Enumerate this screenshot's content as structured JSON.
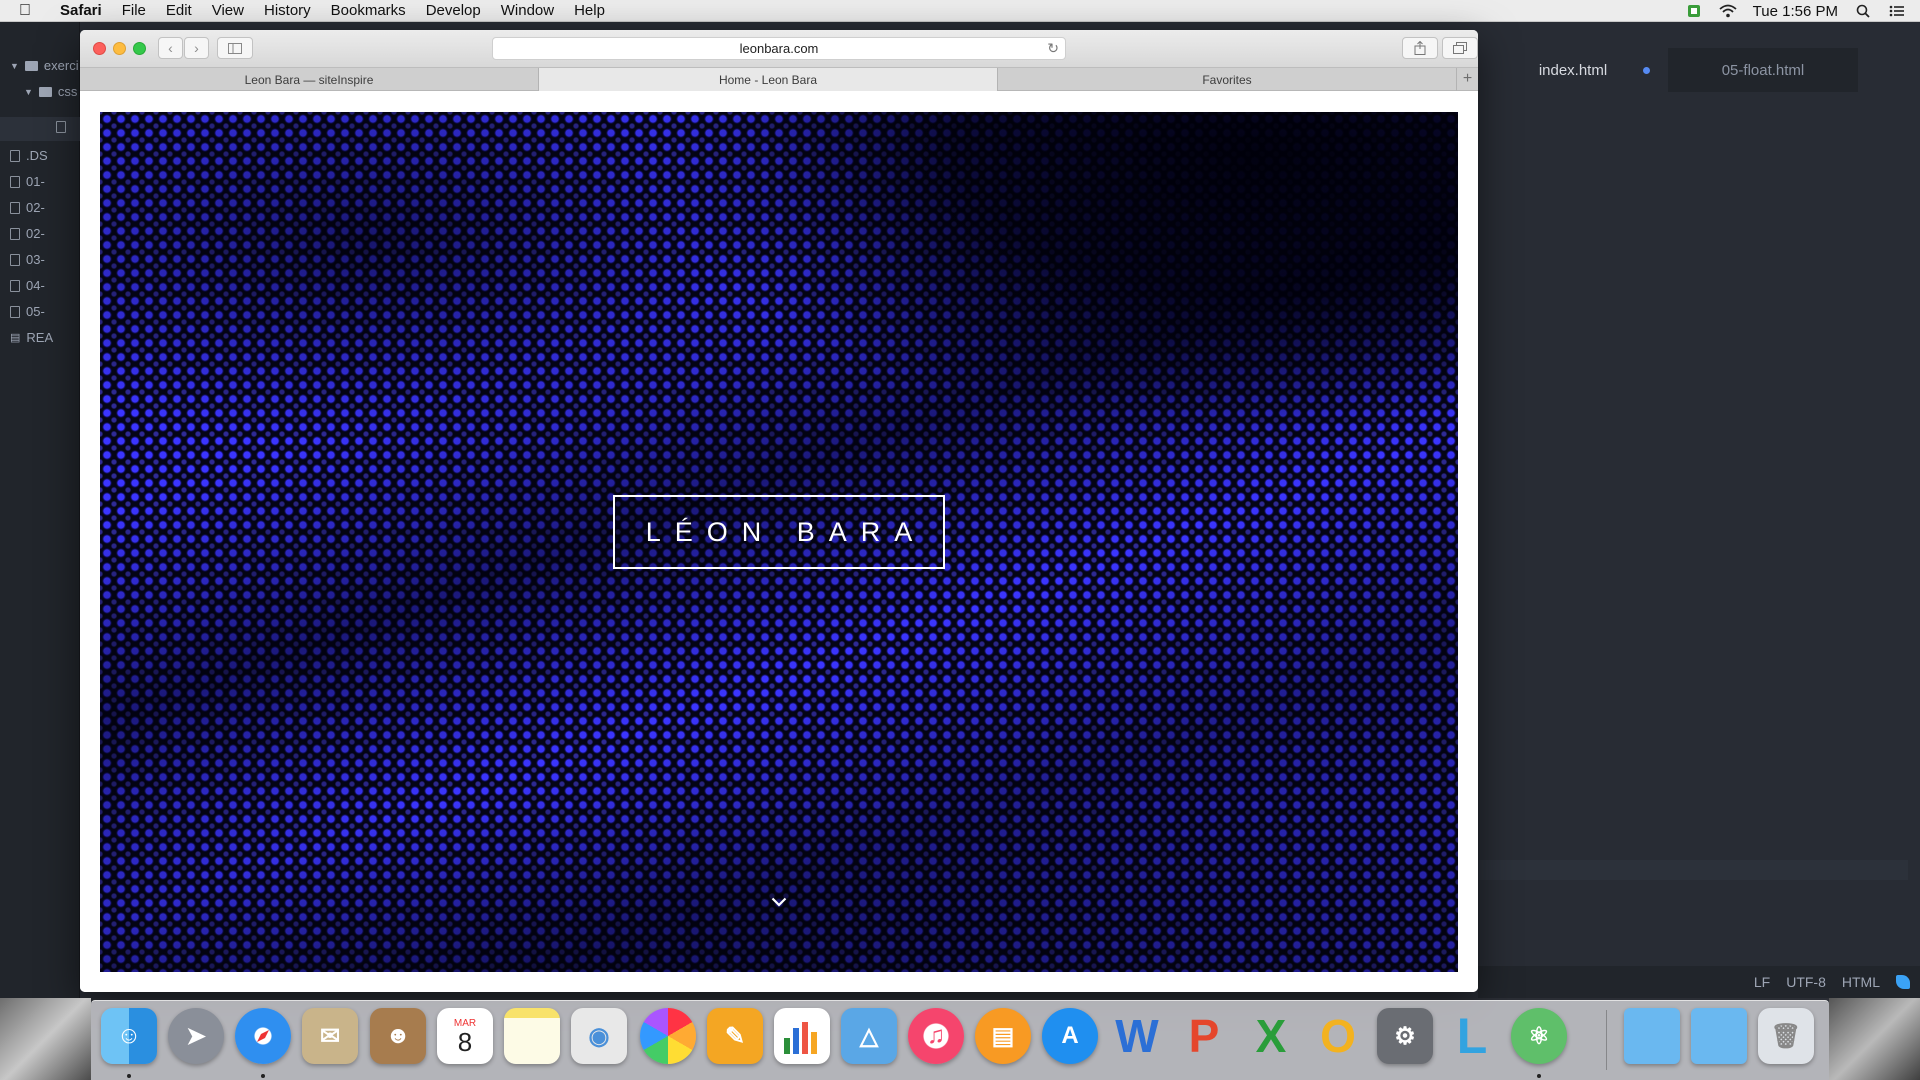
{
  "menubar": {
    "app_name": "Safari",
    "items": [
      "File",
      "Edit",
      "View",
      "History",
      "Bookmarks",
      "Develop",
      "Window",
      "Help"
    ],
    "clock": "Tue 1:56 PM"
  },
  "editor": {
    "tree_items": [
      "exerci",
      "css",
      "",
      ".DS",
      "01-",
      "02-",
      "02-",
      "03-",
      "04-",
      "05-",
      "REA"
    ],
    "tabs": [
      {
        "label": "index.html",
        "modified": true
      },
      {
        "label": "05-float.html",
        "modified": false
      }
    ],
    "status": {
      "line_ending": "LF",
      "encoding": "UTF-8",
      "grammar": "HTML"
    }
  },
  "browser": {
    "url": "leonbara.com",
    "tabs": [
      "Leon Bara — siteInspire",
      "Home - Leon Bara",
      "Favorites"
    ],
    "active_tab_index": 1,
    "new_tab_symbol": "+"
  },
  "page": {
    "logo": "LÉON BARA",
    "accent_color": "#3b35ff",
    "background_color": "#050516"
  },
  "dock": {
    "calendar_month": "MAR",
    "calendar_day": "8"
  }
}
